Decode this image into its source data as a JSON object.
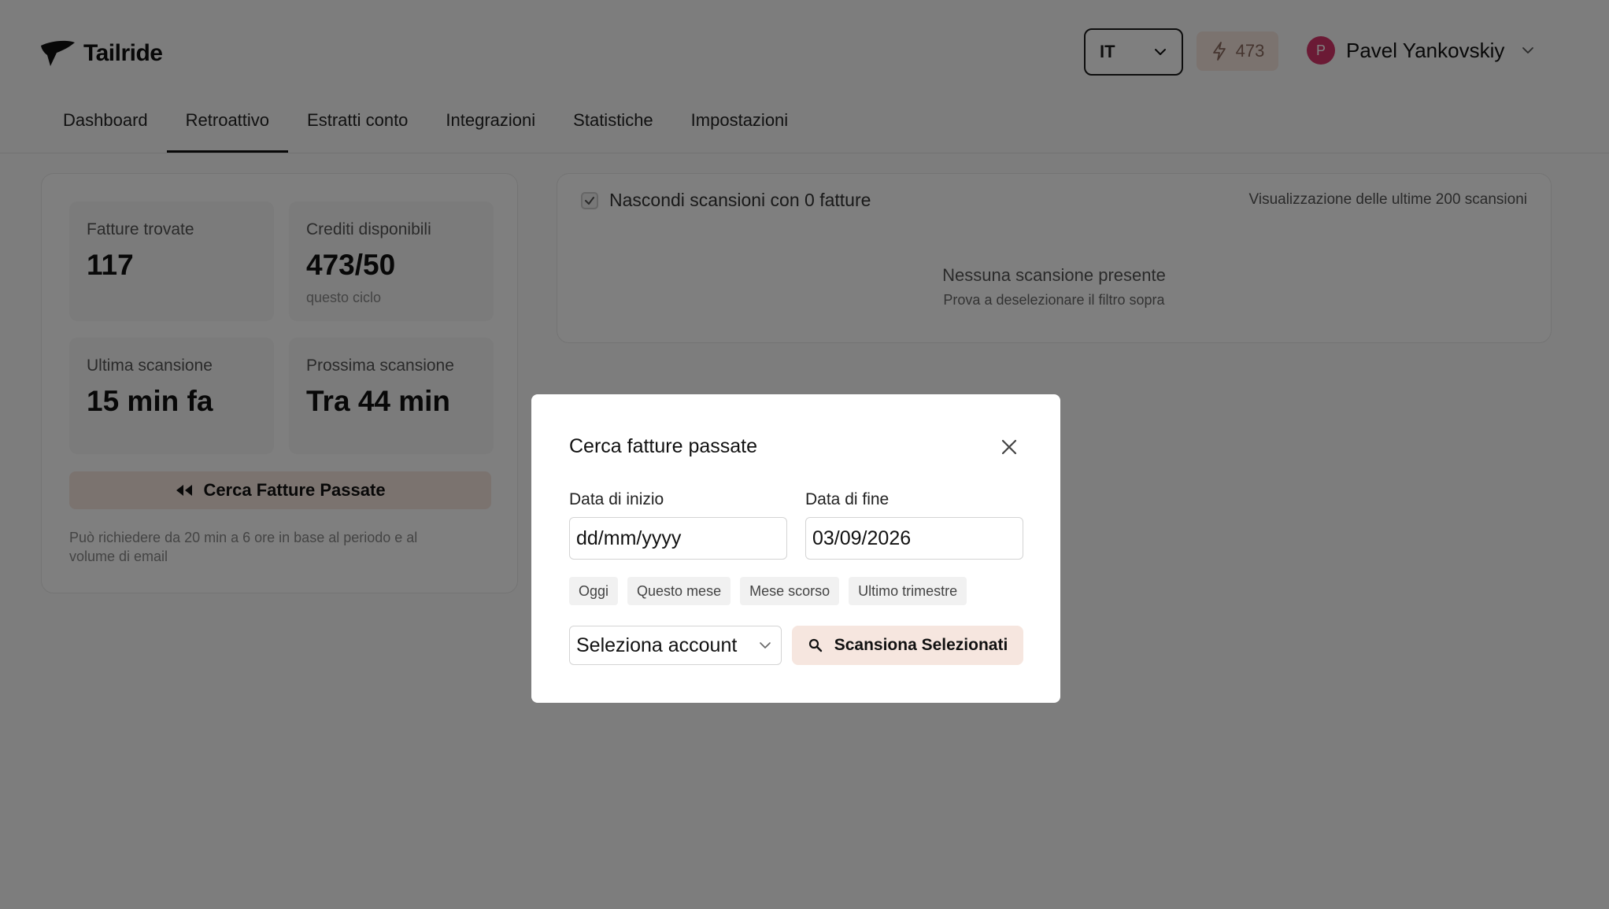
{
  "brand": {
    "name": "Tailride"
  },
  "header": {
    "language": "IT",
    "credits": "473",
    "user": {
      "initial": "P",
      "name": "Pavel Yankovskiy"
    }
  },
  "nav": {
    "tabs": [
      {
        "label": "Dashboard"
      },
      {
        "label": "Retroattivo"
      },
      {
        "label": "Estratti conto"
      },
      {
        "label": "Integrazioni"
      },
      {
        "label": "Statistiche"
      },
      {
        "label": "Impostazioni"
      }
    ]
  },
  "stats": {
    "invoices_found": {
      "label": "Fatture trovate",
      "value": "117"
    },
    "credits": {
      "label": "Crediti disponibili",
      "value": "473/50",
      "sub": "questo ciclo"
    },
    "last_scan": {
      "label": "Ultima scansione",
      "value": "15 min fa"
    },
    "next_scan": {
      "label": "Prossima scansione",
      "value": "Tra 44 min"
    }
  },
  "search_past": {
    "button_label": "Cerca Fatture Passate",
    "note": "Può richiedere da 20 min a 6 ore in base al periodo e al volume di email"
  },
  "scans": {
    "filter_label": "Nascondi scansioni con 0 fatture",
    "filter_checked": true,
    "showing": "Visualizzazione delle ultime 200 scansioni",
    "empty_title": "Nessuna scansione presente",
    "empty_sub": "Prova a deselezionare il filtro sopra"
  },
  "modal": {
    "title": "Cerca fatture passate",
    "start_label": "Data di inizio",
    "start_value": "dd/mm/yyyy",
    "end_label": "Data di fine",
    "end_value": "03/09/2026",
    "presets": [
      {
        "label": "Oggi"
      },
      {
        "label": "Questo mese"
      },
      {
        "label": "Mese scorso"
      },
      {
        "label": "Ultimo trimestre"
      }
    ],
    "account_select": "Seleziona account",
    "scan_button": "Scansiona Selezionati"
  },
  "colors": {
    "accent_bg": "#f6e6df",
    "avatar": "#d7356a",
    "overlay": "rgba(0,0,0,0.5)"
  }
}
